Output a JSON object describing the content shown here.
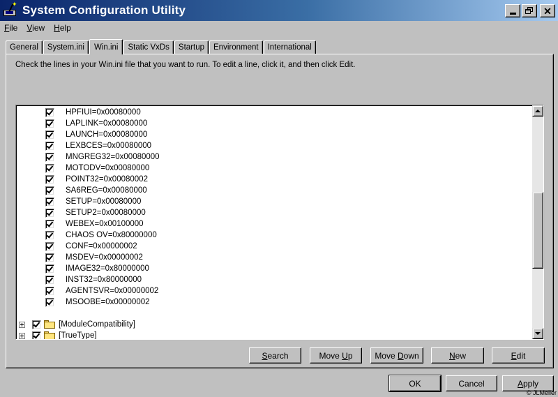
{
  "window": {
    "title": "System Configuration Utility",
    "buttons": {
      "minimize": "minimize",
      "restore": "restore",
      "close": "✕"
    }
  },
  "menu": [
    {
      "key": "F",
      "rest": "ile"
    },
    {
      "key": "V",
      "rest": "iew"
    },
    {
      "key": "H",
      "rest": "elp"
    }
  ],
  "tabs": [
    {
      "label": "General",
      "active": false
    },
    {
      "label": "System.ini",
      "active": false
    },
    {
      "label": "Win.ini",
      "active": true
    },
    {
      "label": "Static VxDs",
      "active": false
    },
    {
      "label": "Startup",
      "active": false
    },
    {
      "label": "Environment",
      "active": false
    },
    {
      "label": "International",
      "active": false
    }
  ],
  "instructions": "Check the lines in your Win.ini file that you want to run. To edit a line, click it, and then click Edit.",
  "list": {
    "entries": [
      {
        "text": "HPFIUI=0x00080000",
        "checked": true
      },
      {
        "text": "LAPLINK=0x00080000",
        "checked": true
      },
      {
        "text": "LAUNCH=0x00080000",
        "checked": true
      },
      {
        "text": "LEXBCES=0x00080000",
        "checked": true
      },
      {
        "text": "MNGREG32=0x00080000",
        "checked": true
      },
      {
        "text": "MOTODV=0x00080000",
        "checked": true
      },
      {
        "text": "POINT32=0x00080002",
        "checked": true
      },
      {
        "text": "SA6REG=0x00080000",
        "checked": true
      },
      {
        "text": "SETUP=0x00080000",
        "checked": true
      },
      {
        "text": "SETUP2=0x00080000",
        "checked": true
      },
      {
        "text": "WEBEX=0x00100000",
        "checked": true
      },
      {
        "text": "CHAOS OV=0x80000000",
        "checked": true
      },
      {
        "text": "CONF=0x00000002",
        "checked": true
      },
      {
        "text": "MSDEV=0x00000002",
        "checked": true
      },
      {
        "text": "IMAGE32=0x80000000",
        "checked": true
      },
      {
        "text": "INST32=0x80000000",
        "checked": true
      },
      {
        "text": "AGENTSVR=0x00000002",
        "checked": true
      },
      {
        "text": "MSOOBE=0x00000002",
        "checked": true
      }
    ],
    "sections": [
      {
        "text": "[ModuleCompatibility]",
        "checked": true
      },
      {
        "text": "[TrueType]",
        "checked": true
      }
    ]
  },
  "buttons": {
    "search": {
      "key": "S",
      "rest": "earch"
    },
    "move_up": {
      "pre": "Move ",
      "key": "U",
      "rest": "p"
    },
    "move_down": {
      "pre": "Move ",
      "key": "D",
      "rest": "own"
    },
    "new": {
      "key": "N",
      "rest": "ew"
    },
    "edit": {
      "key": "E",
      "rest": "dit"
    },
    "ok": "OK",
    "cancel": "Cancel",
    "apply": {
      "key": "A",
      "rest": "pply"
    }
  },
  "credit": "© JLMeller"
}
